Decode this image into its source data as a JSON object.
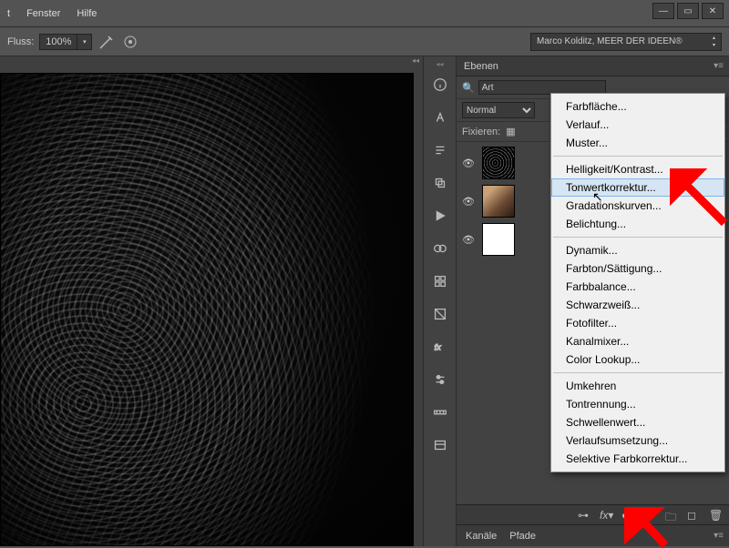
{
  "menubar": {
    "items": [
      "t",
      "Fenster",
      "Hilfe"
    ]
  },
  "window_controls": {
    "minimize": "—",
    "maximize": "▭",
    "close": "✕"
  },
  "optionsbar": {
    "fluss_label": "Fluss:",
    "fluss_value": "100%",
    "workspace": "Marco Kolditz, MEER DER IDEEN®"
  },
  "iconstrip": [
    "info-icon",
    "text-icon",
    "paragraph-icon",
    "clone-icon",
    "play-icon",
    "swatches-icon",
    "grid-icon",
    "styles-icon",
    "fx-icon",
    "adjust-icon",
    "measure-icon",
    "library-icon"
  ],
  "layers_panel": {
    "tab": "Ebenen",
    "filter_label": "Art",
    "blend_mode": "Normal",
    "lock_label": "Fixieren:"
  },
  "layers": [
    {
      "visible": true,
      "thumb": "edge"
    },
    {
      "visible": true,
      "thumb": "photo"
    },
    {
      "visible": true,
      "thumb": "white"
    }
  ],
  "bottom_tabs": {
    "a": "Kanäle",
    "b": "Pfade"
  },
  "context_menu": {
    "group1": [
      "Farbfläche...",
      "Verlauf...",
      "Muster..."
    ],
    "group2": [
      "Helligkeit/Kontrast...",
      "Tonwertkorrektur...",
      "Gradationskurven...",
      "Belichtung..."
    ],
    "group3": [
      "Dynamik...",
      "Farbton/Sättigung...",
      "Farbbalance...",
      "Schwarzweiß...",
      "Fotofilter...",
      "Kanalmixer...",
      "Color Lookup..."
    ],
    "group4": [
      "Umkehren",
      "Tontrennung...",
      "Schwellenwert...",
      "Verlaufsumsetzung...",
      "Selektive Farbkorrektur..."
    ],
    "highlighted": "Tonwertkorrektur..."
  }
}
